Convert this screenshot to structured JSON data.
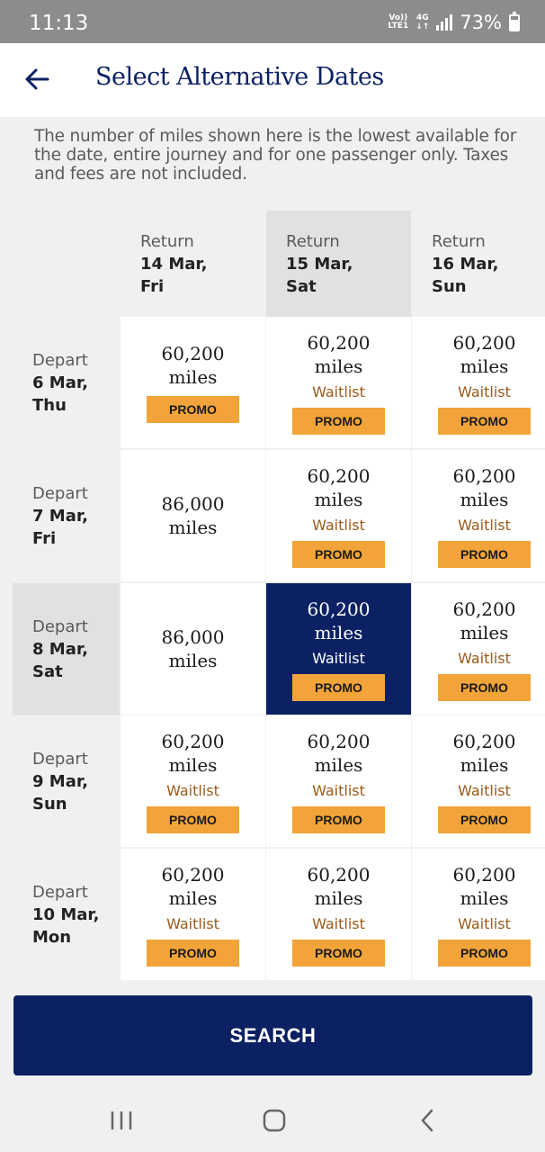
{
  "status_bar": {
    "time": "11:13",
    "volte_top": "Vo))",
    "volte_bottom": "LTE1",
    "network": "4G",
    "battery": "73%"
  },
  "header": {
    "title": "Select Alternative Dates",
    "back_icon": "arrow-left-icon"
  },
  "info_text": "The number of miles shown here is the lowest available for the date, entire journey and for one passenger only. Taxes and fees are not included.",
  "columns": [
    {
      "label": "Return",
      "date": "14 Mar,",
      "day": "Fri"
    },
    {
      "label": "Return",
      "date": "15 Mar,",
      "day": "Sat"
    },
    {
      "label": "Return",
      "date": "16 Mar,",
      "day": "Sun"
    }
  ],
  "rows": [
    {
      "label": "Depart",
      "date": "6 Mar,",
      "day": "Thu",
      "cells": [
        {
          "miles": "60,200",
          "unit": "miles",
          "waitlist": "",
          "promo": "PROMO"
        },
        {
          "miles": "60,200",
          "unit": "miles",
          "waitlist": "Waitlist",
          "promo": "PROMO"
        },
        {
          "miles": "60,200",
          "unit": "miles",
          "waitlist": "Waitlist",
          "promo": "PROMO"
        }
      ]
    },
    {
      "label": "Depart",
      "date": "7 Mar,",
      "day": "Fri",
      "cells": [
        {
          "miles": "86,000",
          "unit": "miles",
          "waitlist": "",
          "promo": ""
        },
        {
          "miles": "60,200",
          "unit": "miles",
          "waitlist": "Waitlist",
          "promo": "PROMO"
        },
        {
          "miles": "60,200",
          "unit": "miles",
          "waitlist": "Waitlist",
          "promo": "PROMO"
        }
      ]
    },
    {
      "label": "Depart",
      "date": "8 Mar,",
      "day": "Sat",
      "cells": [
        {
          "miles": "86,000",
          "unit": "miles",
          "waitlist": "",
          "promo": ""
        },
        {
          "miles": "60,200",
          "unit": "miles",
          "waitlist": "Waitlist",
          "promo": "PROMO"
        },
        {
          "miles": "60,200",
          "unit": "miles",
          "waitlist": "Waitlist",
          "promo": "PROMO"
        }
      ]
    },
    {
      "label": "Depart",
      "date": "9 Mar,",
      "day": "Sun",
      "cells": [
        {
          "miles": "60,200",
          "unit": "miles",
          "waitlist": "Waitlist",
          "promo": "PROMO"
        },
        {
          "miles": "60,200",
          "unit": "miles",
          "waitlist": "Waitlist",
          "promo": "PROMO"
        },
        {
          "miles": "60,200",
          "unit": "miles",
          "waitlist": "Waitlist",
          "promo": "PROMO"
        }
      ]
    },
    {
      "label": "Depart",
      "date": "10 Mar,",
      "day": "Mon",
      "cells": [
        {
          "miles": "60,200",
          "unit": "miles",
          "waitlist": "Waitlist",
          "promo": "PROMO"
        },
        {
          "miles": "60,200",
          "unit": "miles",
          "waitlist": "Waitlist",
          "promo": "PROMO"
        },
        {
          "miles": "60,200",
          "unit": "miles",
          "waitlist": "Waitlist",
          "promo": "PROMO"
        }
      ]
    }
  ],
  "selected": {
    "row": 2,
    "col": 1
  },
  "search_label": "SEARCH",
  "nav": {
    "recents_icon": "recents-icon",
    "home_icon": "home-icon",
    "back_icon": "back-chevron-icon"
  },
  "colors": {
    "brand_navy": "#0b2163",
    "promo_orange": "#f2a43a",
    "waitlist_brown": "#9a5a1a"
  }
}
